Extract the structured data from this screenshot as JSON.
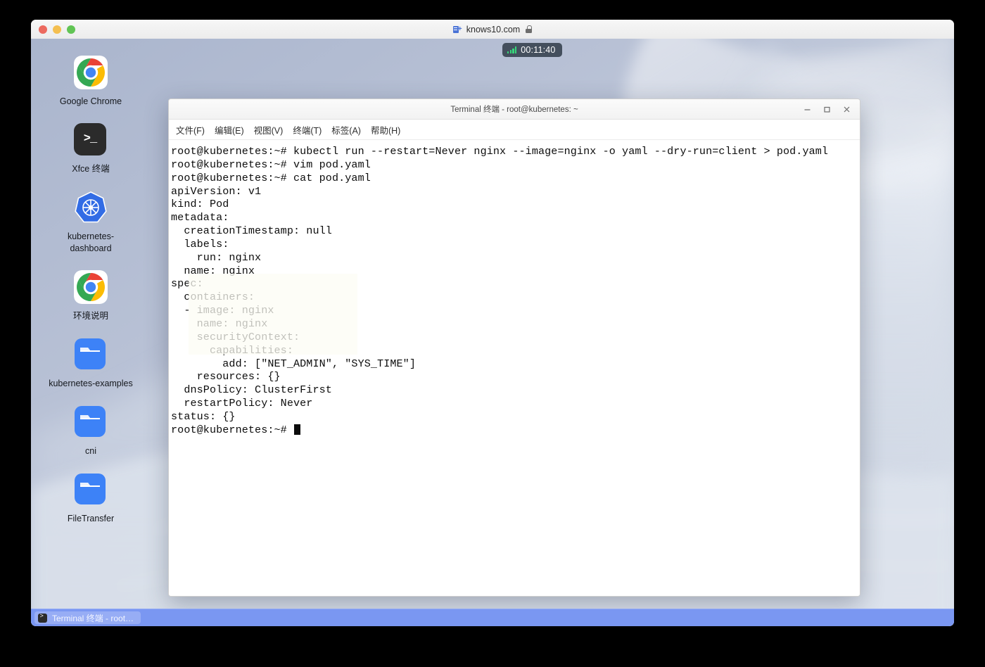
{
  "browser": {
    "url": "knows10.com",
    "traffic_lights": [
      "close",
      "minimize",
      "zoom"
    ],
    "extension_icon": "extension-add-icon",
    "lock_icon": "lock-icon"
  },
  "timer": {
    "value": "00:11:40",
    "signal_icon": "signal-bars-icon"
  },
  "desktop": {
    "icons": [
      {
        "label": "Google Chrome",
        "icon": "chrome-icon",
        "type": "app"
      },
      {
        "label": "Xfce 终端",
        "icon": "terminal-icon",
        "type": "app"
      },
      {
        "label": "kubernetes-dashboard",
        "icon": "kubernetes-icon",
        "type": "app"
      },
      {
        "label": "环境说明",
        "icon": "chrome-icon",
        "type": "app"
      },
      {
        "label": "kubernetes-examples",
        "icon": "folder-icon",
        "type": "folder"
      },
      {
        "label": "cni",
        "icon": "folder-icon",
        "type": "folder"
      },
      {
        "label": "FileTransfer",
        "icon": "folder-icon",
        "type": "folder"
      }
    ]
  },
  "taskbar": {
    "items": [
      {
        "label": "Terminal 终端 - root…",
        "icon": "terminal-icon"
      }
    ]
  },
  "terminal": {
    "title": "Terminal 终端 - root@kubernetes: ~",
    "controls": {
      "minimize": "−",
      "maximize": "□",
      "close": "×"
    },
    "menu": [
      "文件(F)",
      "编辑(E)",
      "视图(V)",
      "终端(T)",
      "标签(A)",
      "帮助(H)"
    ],
    "lines": [
      "root@kubernetes:~# kubectl run --restart=Never nginx --image=nginx -o yaml --dry-run=client > pod.yaml",
      "root@kubernetes:~# vim pod.yaml",
      "root@kubernetes:~# cat pod.yaml",
      "apiVersion: v1",
      "kind: Pod",
      "metadata:",
      "  creationTimestamp: null",
      "  labels:",
      "    run: nginx",
      "  name: nginx",
      "spec:",
      "  containers:",
      "  - image: nginx",
      "    name: nginx",
      "    securityContext:",
      "      capabilities:",
      "        add: [\"NET_ADMIN\", \"SYS_TIME\"]",
      "    resources: {}",
      "  dnsPolicy: ClusterFirst",
      "  restartPolicy: Never",
      "status: {}"
    ],
    "prompt": "root@kubernetes:~# "
  },
  "colors": {
    "taskbar": "#7a97f2",
    "timer_badge": "#444f5d",
    "signal_green": "#37d67a",
    "terminal_text": "#0c0c0c",
    "kubernetes_blue": "#326ce5",
    "folder_blue": "#3d82f7"
  }
}
